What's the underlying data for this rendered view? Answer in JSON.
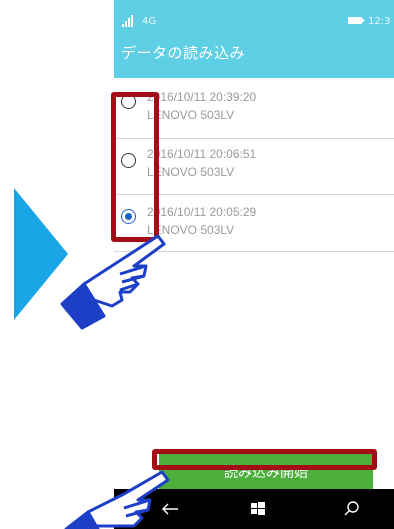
{
  "status_bar": {
    "network": "4G",
    "time": "12:3"
  },
  "header": {
    "title": "データの読み込み"
  },
  "records": [
    {
      "date": "2016/10/11 20:39:20",
      "device": "LENOVO 503LV",
      "selected": false
    },
    {
      "date": "2016/10/11 20:06:51",
      "device": "LENOVO 503LV",
      "selected": false
    },
    {
      "date": "2016/10/11 20:05:29",
      "device": "LENOVO 503LV",
      "selected": true
    }
  ],
  "actions": {
    "start_label": "読み込み開始"
  },
  "nav": {
    "back": "back-arrow-icon",
    "home": "windows-icon",
    "search": "search-icon"
  },
  "colors": {
    "header": "#5fcfe6",
    "highlight": "#a30d16",
    "button": "#4caf3c",
    "arrow": "#1aa6e6",
    "hand": "#1d3fc8"
  }
}
